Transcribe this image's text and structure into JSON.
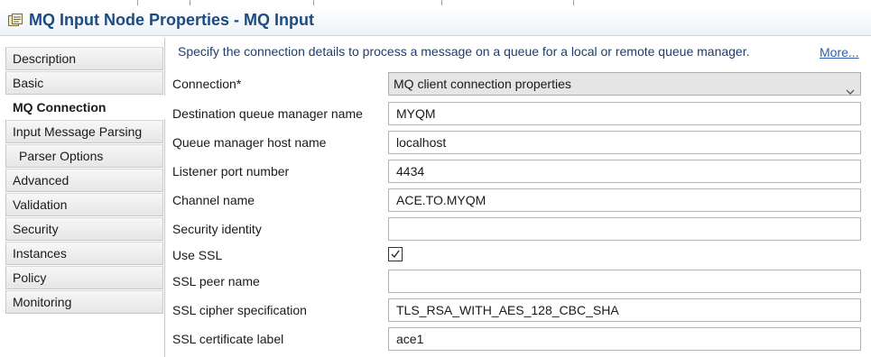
{
  "header": {
    "title": "MQ Input Node Properties - MQ Input",
    "icon": "properties-icon"
  },
  "sidebar": {
    "items": [
      {
        "label": "Description",
        "active": false,
        "sub": false
      },
      {
        "label": "Basic",
        "active": false,
        "sub": false
      },
      {
        "label": "MQ Connection",
        "active": true,
        "sub": false
      },
      {
        "label": "Input Message Parsing",
        "active": false,
        "sub": false
      },
      {
        "label": "Parser Options",
        "active": false,
        "sub": true
      },
      {
        "label": "Advanced",
        "active": false,
        "sub": false
      },
      {
        "label": "Validation",
        "active": false,
        "sub": false
      },
      {
        "label": "Security",
        "active": false,
        "sub": false
      },
      {
        "label": "Instances",
        "active": false,
        "sub": false
      },
      {
        "label": "Policy",
        "active": false,
        "sub": false
      },
      {
        "label": "Monitoring",
        "active": false,
        "sub": false
      }
    ]
  },
  "content": {
    "info": "Specify the connection details to process a message on a queue for a local or remote queue manager.",
    "more_link": "More...",
    "connection": {
      "label": "Connection*",
      "value": "MQ client connection properties"
    },
    "fields": [
      {
        "label": "Destination queue manager name",
        "value": "MYQM"
      },
      {
        "label": "Queue manager host name",
        "value": "localhost"
      },
      {
        "label": "Listener port number",
        "value": "4434"
      },
      {
        "label": "Channel name",
        "value": "ACE.TO.MYQM"
      },
      {
        "label": "Security identity",
        "value": ""
      }
    ],
    "use_ssl": {
      "label": "Use SSL",
      "checked": true
    },
    "ssl_fields": [
      {
        "label": "SSL peer name",
        "value": ""
      },
      {
        "label": "SSL cipher specification",
        "value": "TLS_RSA_WITH_AES_128_CBC_SHA"
      },
      {
        "label": "SSL certificate label",
        "value": "ace1"
      }
    ]
  },
  "colors": {
    "title": "#1c4b82",
    "info": "#1c3e6e",
    "link": "#2a5db0"
  }
}
